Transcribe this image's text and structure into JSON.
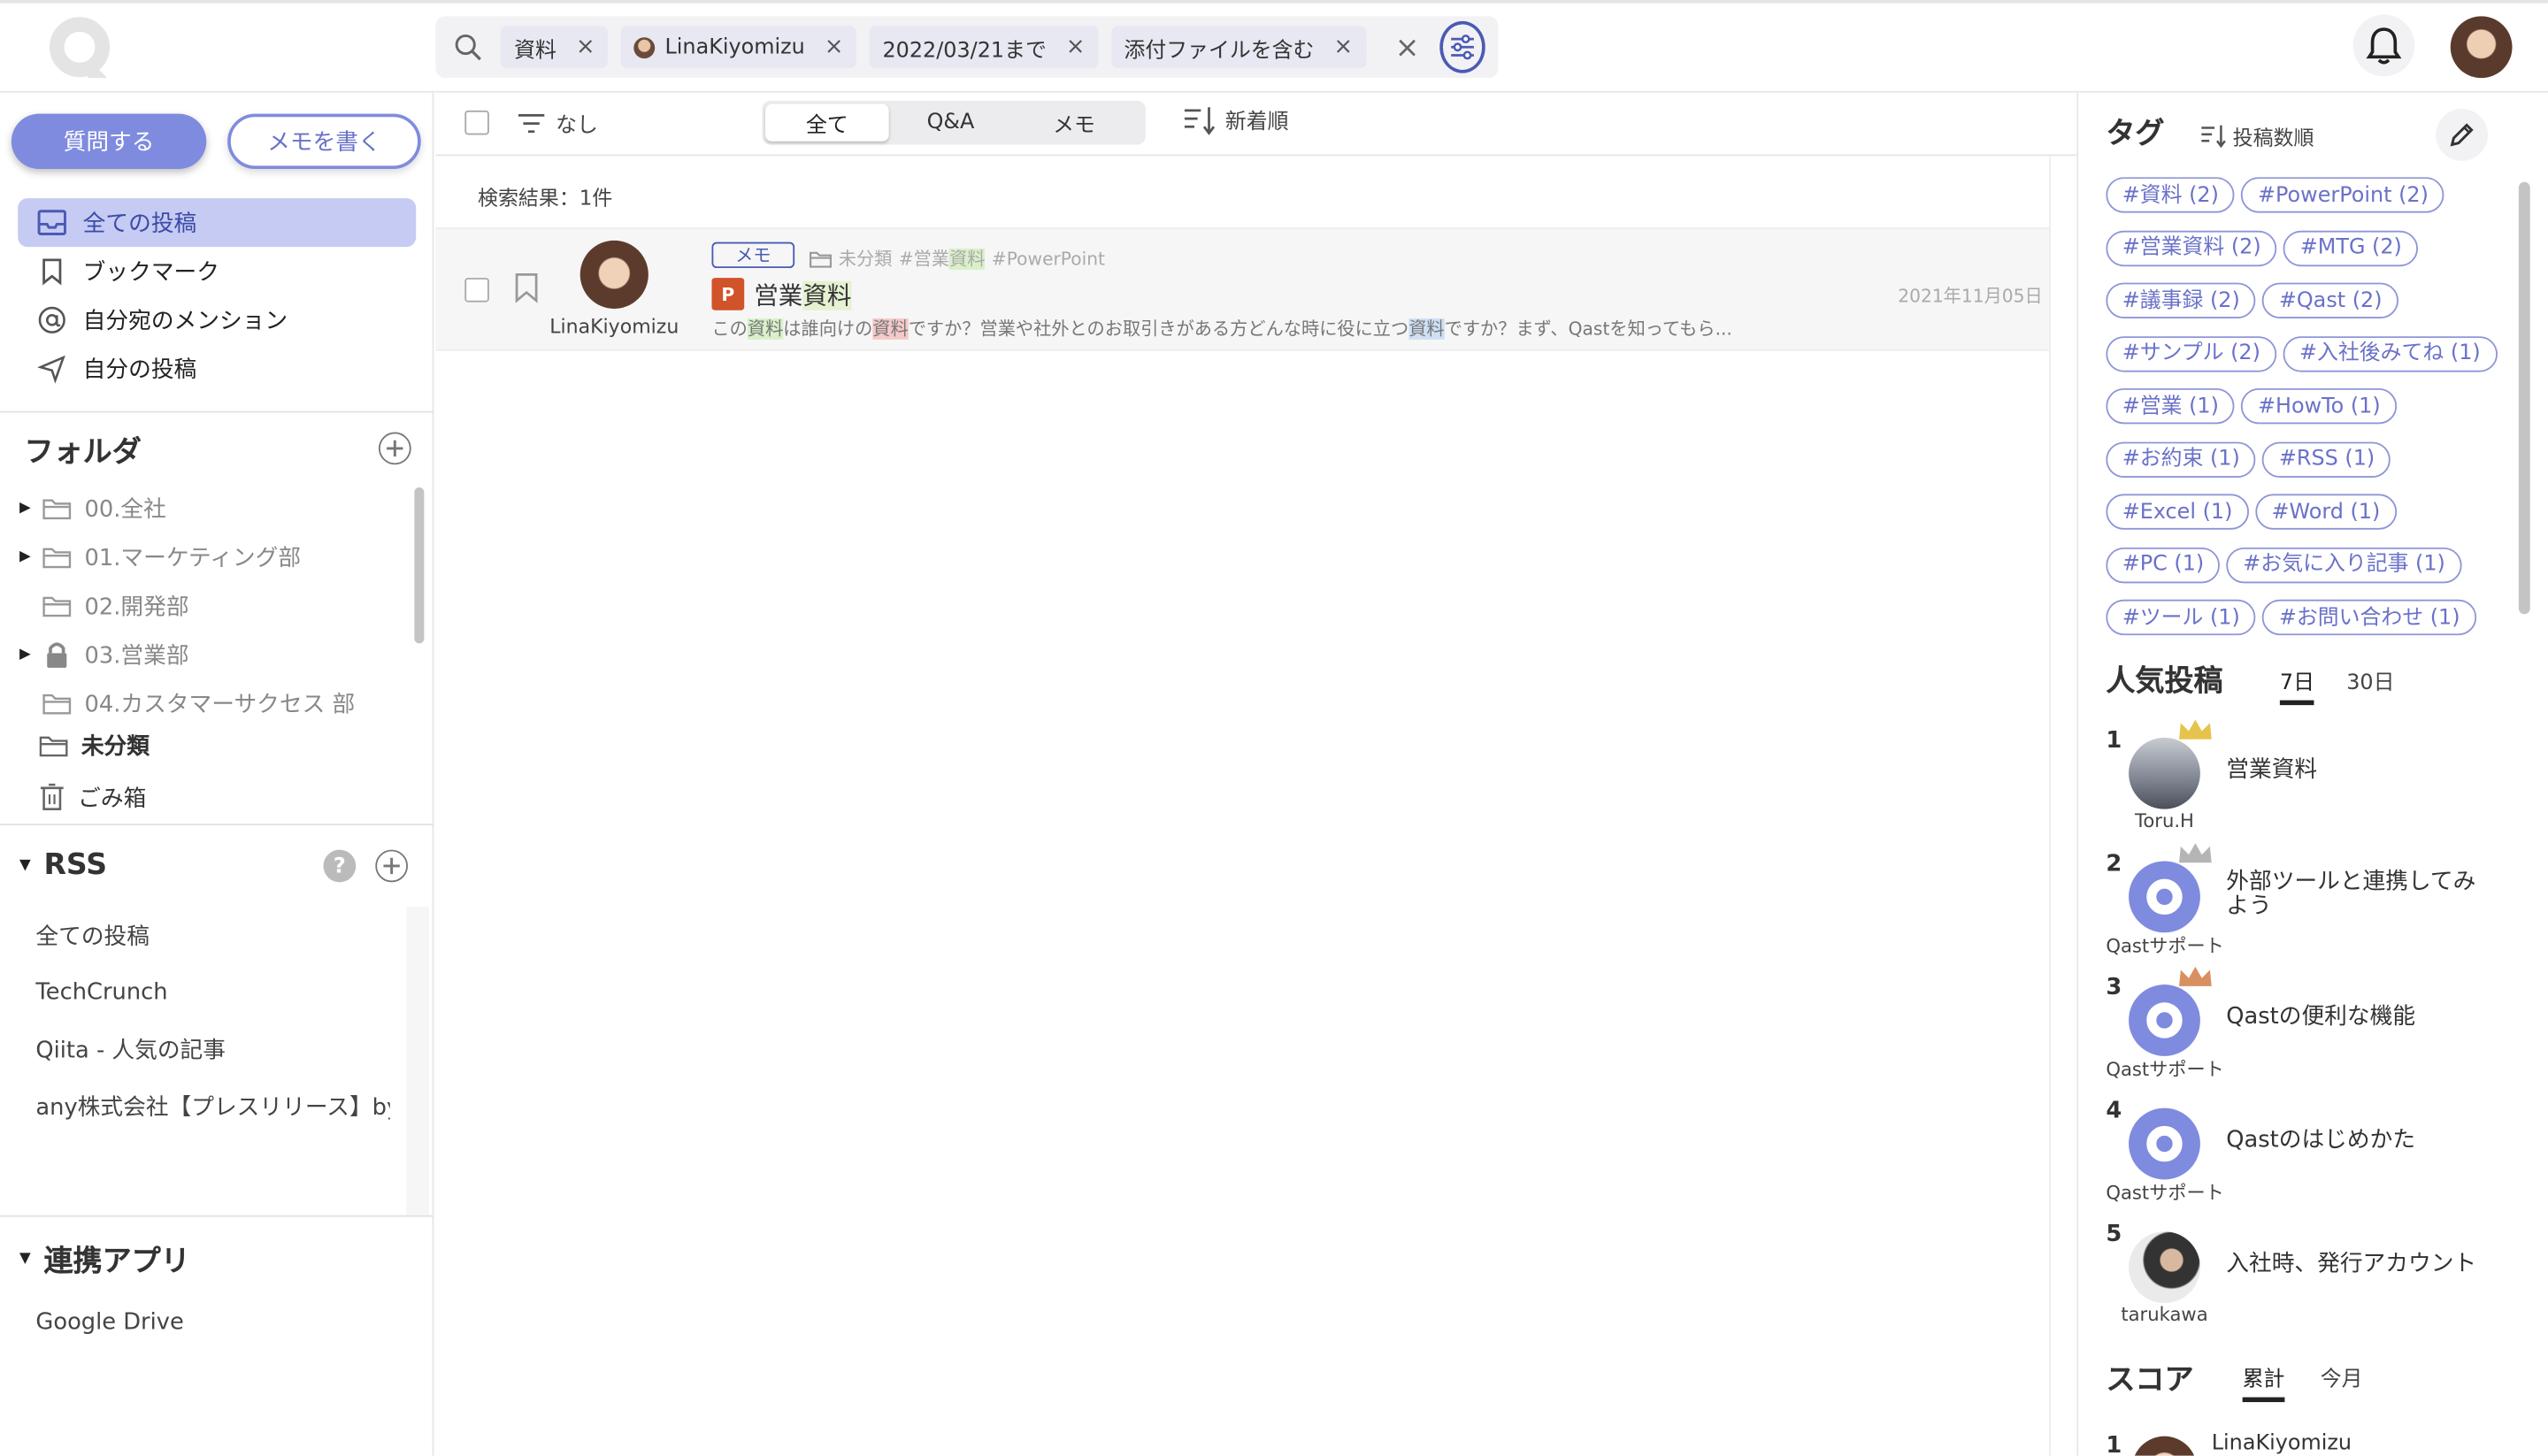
{
  "search": {
    "chips": [
      {
        "label": "資料"
      },
      {
        "label": "LinaKiyomizu"
      },
      {
        "label": "2022/03/21まで"
      },
      {
        "label": "添付ファイルを含む"
      }
    ],
    "close_symbol": "×"
  },
  "sidebar": {
    "ask_button": "質問する",
    "memo_button": "メモを書く",
    "nav": [
      {
        "label": "全ての投稿",
        "icon": "inbox-icon"
      },
      {
        "label": "ブックマーク",
        "icon": "bookmark-icon"
      },
      {
        "label": "自分宛のメンション",
        "icon": "at-icon"
      },
      {
        "label": "自分の投稿",
        "icon": "send-icon"
      }
    ],
    "folders_title": "フォルダ",
    "folders": [
      {
        "label": "00.全社"
      },
      {
        "label": "01.マーケティング部"
      },
      {
        "label": "02.開発部"
      },
      {
        "label": "03.営業部"
      },
      {
        "label": "04.カスタマーサクセス 部"
      }
    ],
    "uncategorized": "未分類",
    "trash": "ごみ箱",
    "rss_title": "RSS",
    "rss_items": [
      {
        "label": "全ての投稿"
      },
      {
        "label": "TechCrunch"
      },
      {
        "label": "Qiita - 人気の記事"
      },
      {
        "label": "any株式会社【プレスリリース】by..."
      }
    ],
    "apps_title": "連携アプリ",
    "apps": [
      {
        "label": "Google Drive"
      }
    ]
  },
  "toolbar": {
    "filter_label": "なし",
    "tabs": [
      {
        "label": "全て"
      },
      {
        "label": "Q&A"
      },
      {
        "label": "メモ"
      }
    ],
    "sort_label": "新着順"
  },
  "results": {
    "count_label": "検索結果：1件"
  },
  "post": {
    "type_badge": "メモ",
    "folder": "未分類",
    "tags_prefix": "#営業",
    "tags_highlight": "資料",
    "tags_suffix": "#PowerPoint",
    "file_badge": "P",
    "title_prefix": "営業",
    "title_highlight": "資料",
    "author": "LinaKiyomizu",
    "date": "2021年11月05日",
    "excerpt_1": "この",
    "excerpt_2": "資料",
    "excerpt_3": "は誰向けの",
    "excerpt_4": "資料",
    "excerpt_5": "ですか？営業や社外とのお取引きがある方どんな時に役に立つ",
    "excerpt_6": "資料",
    "excerpt_7": "ですか？まず、Qastを知ってもら..."
  },
  "tags_panel": {
    "title": "タグ",
    "sort_label": "投稿数順",
    "tags": [
      "#資料 (2)",
      "#PowerPoint (2)",
      "#営業資料 (2)",
      "#MTG (2)",
      "#議事録 (2)",
      "#Qast (2)",
      "#サンプル (2)",
      "#入社後みてね (1)",
      "#営業 (1)",
      "#HowTo (1)",
      "#お約束 (1)",
      "#RSS (1)",
      "#Excel (1)",
      "#Word (1)",
      "#PC (1)",
      "#お気に入り記事 (1)",
      "#ツール (1)",
      "#お問い合わせ (1)"
    ]
  },
  "popular": {
    "title": "人気投稿",
    "tab_7d": "7日",
    "tab_30d": "30日",
    "items": [
      {
        "rank": "1",
        "name": "Toru.H",
        "title": "営業資料",
        "crown": "gold"
      },
      {
        "rank": "2",
        "name": "Qastサポート",
        "title": "外部ツールと連携してみよう",
        "crown": "silver"
      },
      {
        "rank": "3",
        "name": "Qastサポート",
        "title": "Qastの便利な機能",
        "crown": "bronze"
      },
      {
        "rank": "4",
        "name": "Qastサポート",
        "title": "Qastのはじめかた"
      },
      {
        "rank": "5",
        "name": "tarukawa",
        "title": "入社時、発行アカウント"
      }
    ]
  },
  "score": {
    "title": "スコア",
    "tab_total": "累計",
    "tab_month": "今月",
    "first_rank": "1",
    "first_name": "LinaKiyomizu"
  },
  "colors": {
    "accent": "#7f8bde",
    "accent_dark": "#6a71c9",
    "tab_active_bg": "#ffffff",
    "gold": "#e6c34a",
    "silver": "#b5b5b5",
    "bronze": "#d89060",
    "highlight_green": "#d9f0c8",
    "highlight_red": "#f6c9c9",
    "highlight_blue": "#cfe0f5"
  }
}
